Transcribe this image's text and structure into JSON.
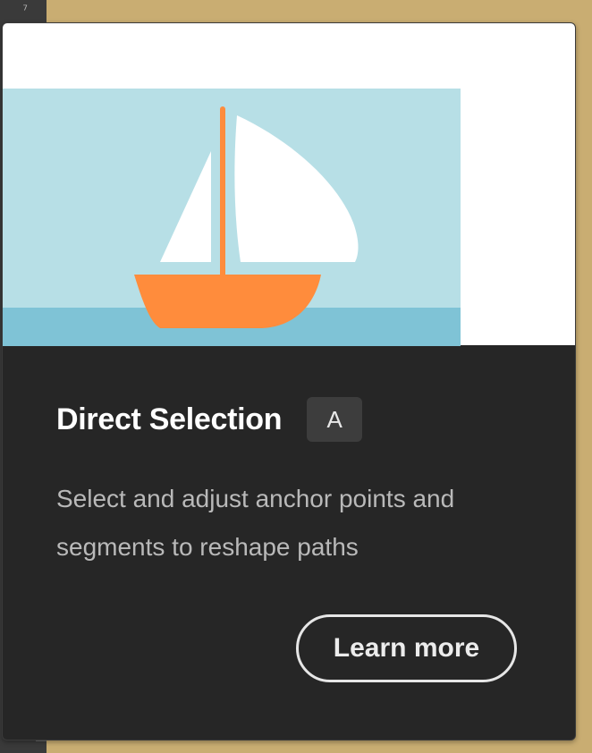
{
  "host_app": {
    "toolbar_glyph": "⁷"
  },
  "tooltip": {
    "tool_name": "Direct Selection",
    "shortcut_key": "A",
    "description": "Select and adjust anchor points and segments to reshape paths",
    "learn_more_label": "Learn more",
    "preview": {
      "illustration": "sailboat-on-water",
      "colors": {
        "sky": "#b7dfe6",
        "water": "#7fc3d6",
        "hull": "#ff8c3c",
        "mast": "#ff8c3c",
        "sails": "#ffffff"
      }
    }
  },
  "colors": {
    "card_background": "#262626",
    "badge_background": "#3d3d3d",
    "title_text": "#ffffff",
    "description_text": "#b9b9b9",
    "button_border": "#e6e6e6",
    "app_background": "#c9ad72"
  }
}
